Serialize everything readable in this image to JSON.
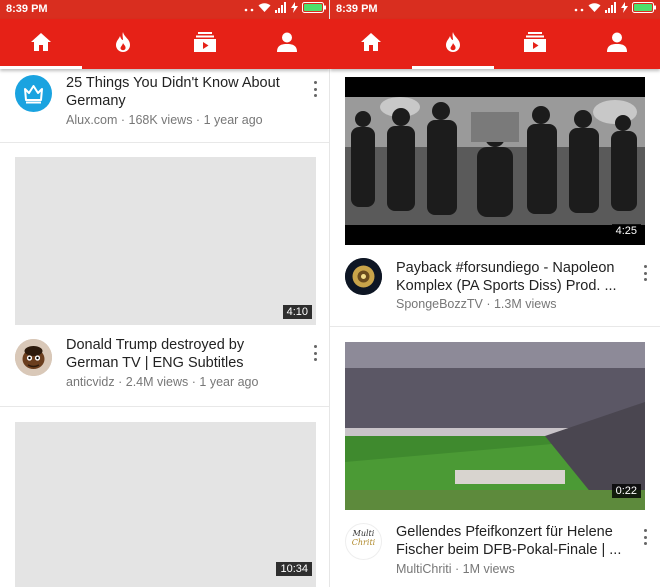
{
  "status_bar": {
    "time_left": "8:39 PM",
    "time_right": "8:39 PM"
  },
  "tabs": [
    {
      "name": "home",
      "icon": "home-icon"
    },
    {
      "name": "trending",
      "icon": "flame-icon"
    },
    {
      "name": "subscriptions",
      "icon": "subscriptions-icon"
    },
    {
      "name": "account",
      "icon": "account-icon"
    }
  ],
  "active_tab": {
    "left": "home",
    "right": "trending"
  },
  "left_feed": [
    {
      "title": "25 Things You Didn't Know About Germany",
      "channel": "Alux.com",
      "views": "168K views",
      "age": "1 year ago"
    },
    {
      "title": "Donald Trump destroyed by German TV | ENG Subtitles",
      "duration": "4:10",
      "channel": "anticvidz",
      "views": "2.4M views",
      "age": "1 year ago"
    },
    {
      "duration": "10:34"
    }
  ],
  "right_feed": [
    {
      "title": "Payback #forsundiego - Napoleon Komplex (PA Sports Diss) Prod. ...",
      "duration": "4:25",
      "channel": "SpongeBozzTV",
      "views": "1.3M views"
    },
    {
      "title": "Gellendes Pfeifkonzert für Helene Fischer beim DFB-Pokal-Finale | ...",
      "duration": "0:22",
      "channel": "MultiChriti",
      "views": "1M views",
      "avatar_text": [
        "Multi",
        "Chriti"
      ]
    }
  ],
  "colors": {
    "app_bar": "#e62117",
    "status_bar": "#d92e1f",
    "avatar_alux": "#1aa3e0"
  }
}
